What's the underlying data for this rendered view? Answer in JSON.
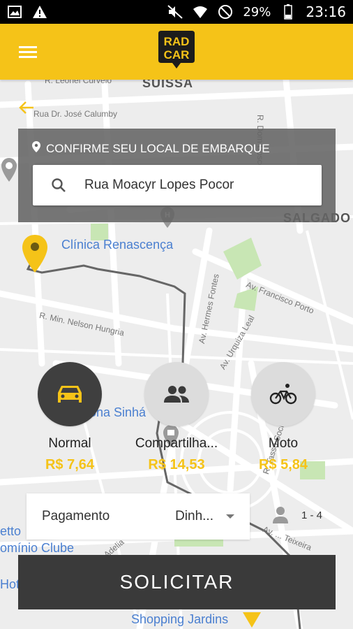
{
  "status_bar": {
    "battery": "29%",
    "time": "23:16"
  },
  "app": {
    "logo_line1": "RAD",
    "logo_line2": "CAR"
  },
  "map": {
    "labels": {
      "street1": "R. Leonel Curvelo",
      "district1": "SUISSA",
      "street2": "Rua Dr. José Calumby",
      "district2": "SALGADO",
      "poi1": "Clínica Renascença",
      "street3": "Av. Francisco Porto",
      "street4": "Av. Hermes Fontes",
      "street5": "R. Min. Nelson Hungria",
      "street6": "Av. Urquiza Leal",
      "street7": "R. Dom Bosco",
      "poi2": "ona Sinhá",
      "poi3": "etto",
      "poi4": "omínio Clube",
      "poi5": "Hot",
      "poi6": "Shopping Jardins",
      "street8": "R. Tasso Sociais",
      "street9": "Av. ... Teixeira",
      "street10": "Adelia"
    },
    "pin_color": "#f5c318",
    "route_color": "#666666"
  },
  "pickup": {
    "title": "CONFIRME SEU LOCAL DE EMBARQUE",
    "address": "Rua Moacyr Lopes Pocor"
  },
  "options": [
    {
      "name": "Normal",
      "price": "R$ 7,64",
      "icon": "car-icon"
    },
    {
      "name": "Compartilha...",
      "price": "R$ 14,53",
      "icon": "people-icon"
    },
    {
      "name": "Moto",
      "price": "R$ 5,84",
      "icon": "bicycle-icon"
    }
  ],
  "payment": {
    "label": "Pagamento",
    "method": "Dinh...",
    "passengers": "1 - 4"
  },
  "cta": {
    "label": "SOLICITAR"
  },
  "colors": {
    "brand_yellow": "#f5c318",
    "dark": "#3a3a3a"
  }
}
